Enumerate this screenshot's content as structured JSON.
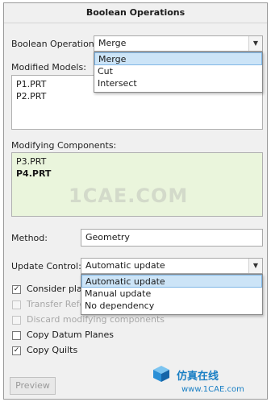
{
  "title": "Boolean Operations",
  "boolean_operation": {
    "label": "Boolean Operation:",
    "value": "Merge",
    "options": [
      "Merge",
      "Cut",
      "Intersect"
    ]
  },
  "modified_models": {
    "label": "Modified Models:",
    "items": [
      "P1.PRT",
      "P2.PRT"
    ]
  },
  "modifying_components": {
    "label": "Modifying Components:",
    "items": [
      "P3.PRT",
      "P4.PRT"
    ]
  },
  "method": {
    "label": "Method:",
    "value": "Geometry"
  },
  "update_control": {
    "label": "Update Control:",
    "value": "Automatic update",
    "options": [
      "Automatic update",
      "Manual update",
      "No dependency"
    ]
  },
  "options": [
    {
      "label": "Consider plac",
      "checked": true,
      "enabled": true
    },
    {
      "label": "Transfer Refe",
      "checked": false,
      "enabled": false
    },
    {
      "label": "Discard modifying components",
      "checked": false,
      "enabled": false
    },
    {
      "label": "Copy Datum Planes",
      "checked": false,
      "enabled": true
    },
    {
      "label": "Copy Quilts",
      "checked": true,
      "enabled": true
    }
  ],
  "preview_label": "Preview",
  "watermark": "1CAE.COM",
  "brand": {
    "cn_text": "仿真在线",
    "url": "www.1CAE.com",
    "color": "#1a7fc4"
  }
}
